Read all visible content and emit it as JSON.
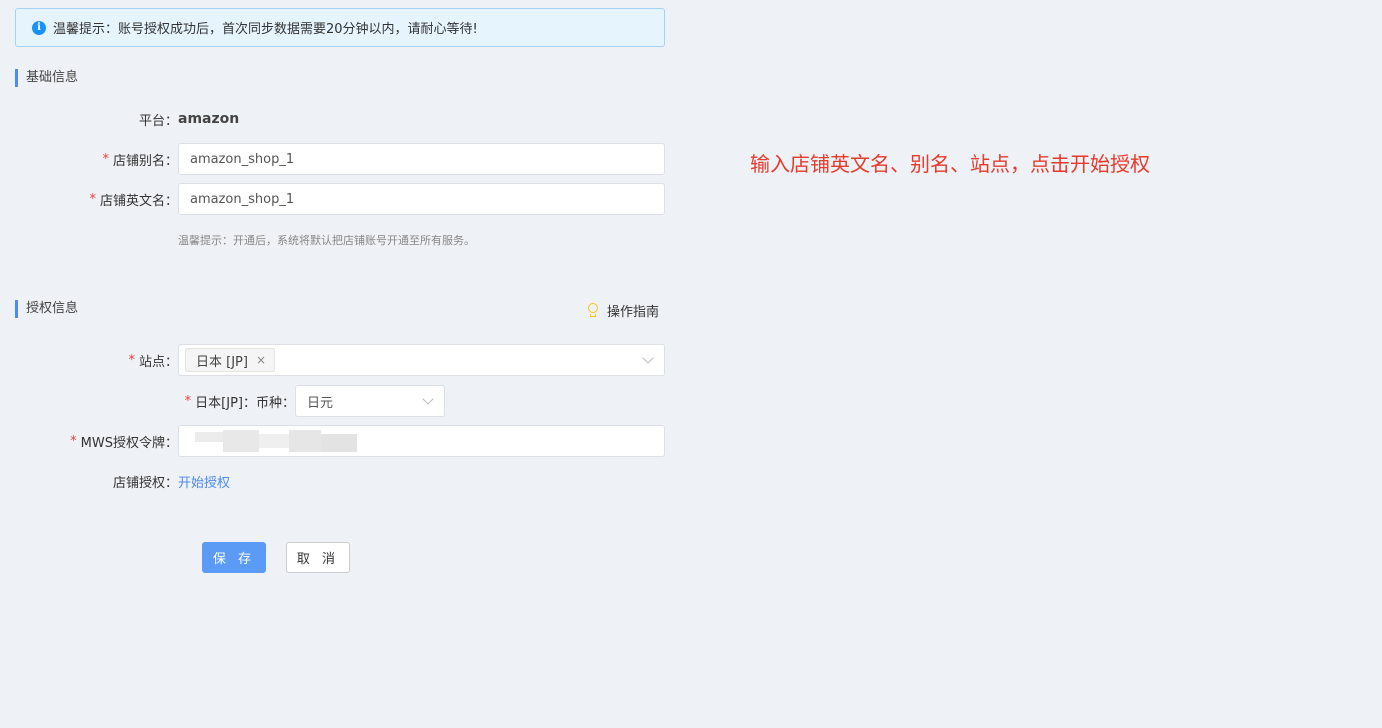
{
  "notice": {
    "text": "温馨提示：账号授权成功后，首次同步数据需要20分钟以内，请耐心等待!"
  },
  "basic_section": {
    "title": "基础信息"
  },
  "platform": {
    "label": "平台：",
    "value": "amazon"
  },
  "shop_alias": {
    "required_mark": "*",
    "label": "店铺别名：",
    "value": "amazon_shop_1"
  },
  "shop_english_name": {
    "required_mark": "*",
    "label": "店铺英文名：",
    "value": "amazon_shop_1"
  },
  "basic_hint": "温馨提示：开通后，系统将默认把店铺账号开通至所有服务。",
  "auth_section": {
    "title": "授权信息",
    "guide_label": "操作指南"
  },
  "site": {
    "required_mark": "*",
    "label": "站点：",
    "selected_tag": "日本 [JP]",
    "tag_close": "×"
  },
  "currency": {
    "required_mark": "*",
    "label": "日本[JP]：币种：",
    "value": "日元"
  },
  "mws_token": {
    "required_mark": "*",
    "label": "MWS授权令牌："
  },
  "shop_auth": {
    "label": "店铺授权：",
    "link": "开始授权"
  },
  "buttons": {
    "save": "保 存",
    "cancel": "取 消"
  },
  "annotation": "输入店铺英文名、别名、站点，点击开始授权",
  "colors": {
    "accent": "#4e8af0",
    "required": "#e94040",
    "annotation": "#e63a2b",
    "notice_bg": "#e6f4fd"
  }
}
